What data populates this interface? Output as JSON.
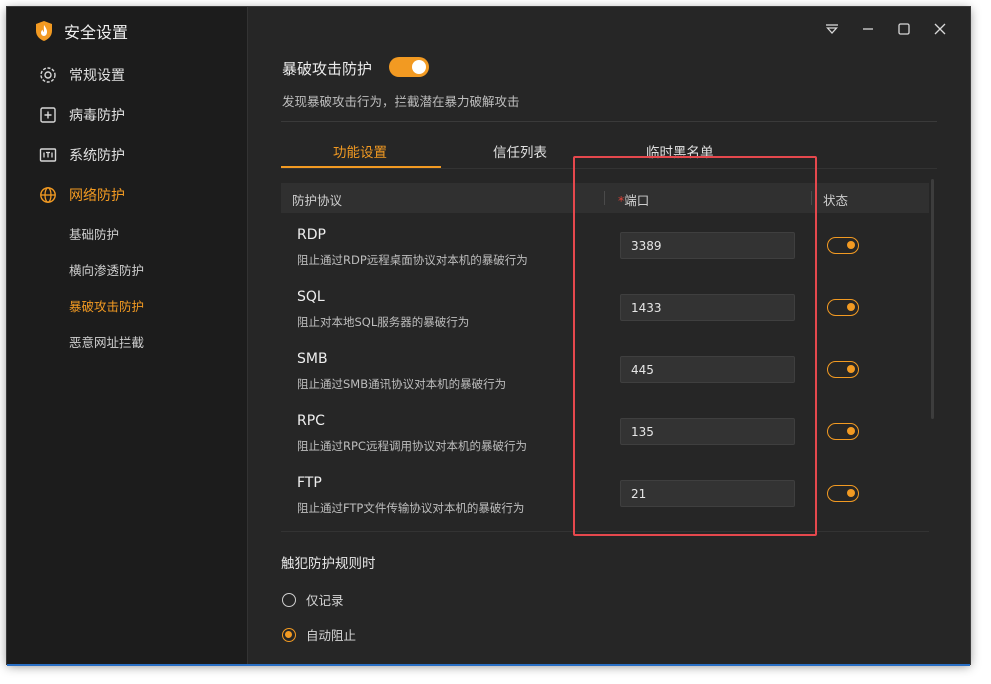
{
  "app": {
    "title": "安全设置"
  },
  "sidebar": {
    "items": [
      {
        "label": "常规设置",
        "icon": "gear-icon"
      },
      {
        "label": "病毒防护",
        "icon": "plus-box-icon"
      },
      {
        "label": "系统防护",
        "icon": "system-box-icon"
      },
      {
        "label": "网络防护",
        "icon": "globe-icon"
      }
    ],
    "subitems": [
      {
        "label": "基础防护"
      },
      {
        "label": "横向渗透防护"
      },
      {
        "label": "暴破攻击防护"
      },
      {
        "label": "恶意网址拦截"
      }
    ]
  },
  "window_controls": [
    "menu-icon",
    "minimize-icon",
    "maximize-icon",
    "close-icon"
  ],
  "main": {
    "title": "暴破攻击防护",
    "toggle_on": true,
    "description": "发现暴破攻击行为，拦截潜在暴力破解攻击",
    "tabs": [
      {
        "label": "功能设置"
      },
      {
        "label": "信任列表"
      },
      {
        "label": "临时黑名单"
      }
    ],
    "table": {
      "headers": {
        "protocol": "防护协议",
        "required_mark": "*",
        "port": "端口",
        "status": "状态"
      },
      "rows": [
        {
          "name": "RDP",
          "desc": "阻止通过RDP远程桌面协议对本机的暴破行为",
          "port": "3389",
          "enabled": true
        },
        {
          "name": "SQL",
          "desc": "阻止对本地SQL服务器的暴破行为",
          "port": "1433",
          "enabled": true
        },
        {
          "name": "SMB",
          "desc": "阻止通过SMB通讯协议对本机的暴破行为",
          "port": "445",
          "enabled": true
        },
        {
          "name": "RPC",
          "desc": "阻止通过RPC远程调用协议对本机的暴破行为",
          "port": "135",
          "enabled": true
        },
        {
          "name": "FTP",
          "desc": "阻止通过FTP文件传输协议对本机的暴破行为",
          "port": "21",
          "enabled": true
        }
      ]
    },
    "rule_section": {
      "title": "触犯防护规则时",
      "options": [
        {
          "label": "仅记录",
          "checked": false
        },
        {
          "label": "自动阻止",
          "checked": true
        }
      ]
    }
  },
  "colors": {
    "accent": "#f29a22",
    "highlight": "#e5484d",
    "background": "#262626",
    "sidebar": "#1c1c1c"
  }
}
